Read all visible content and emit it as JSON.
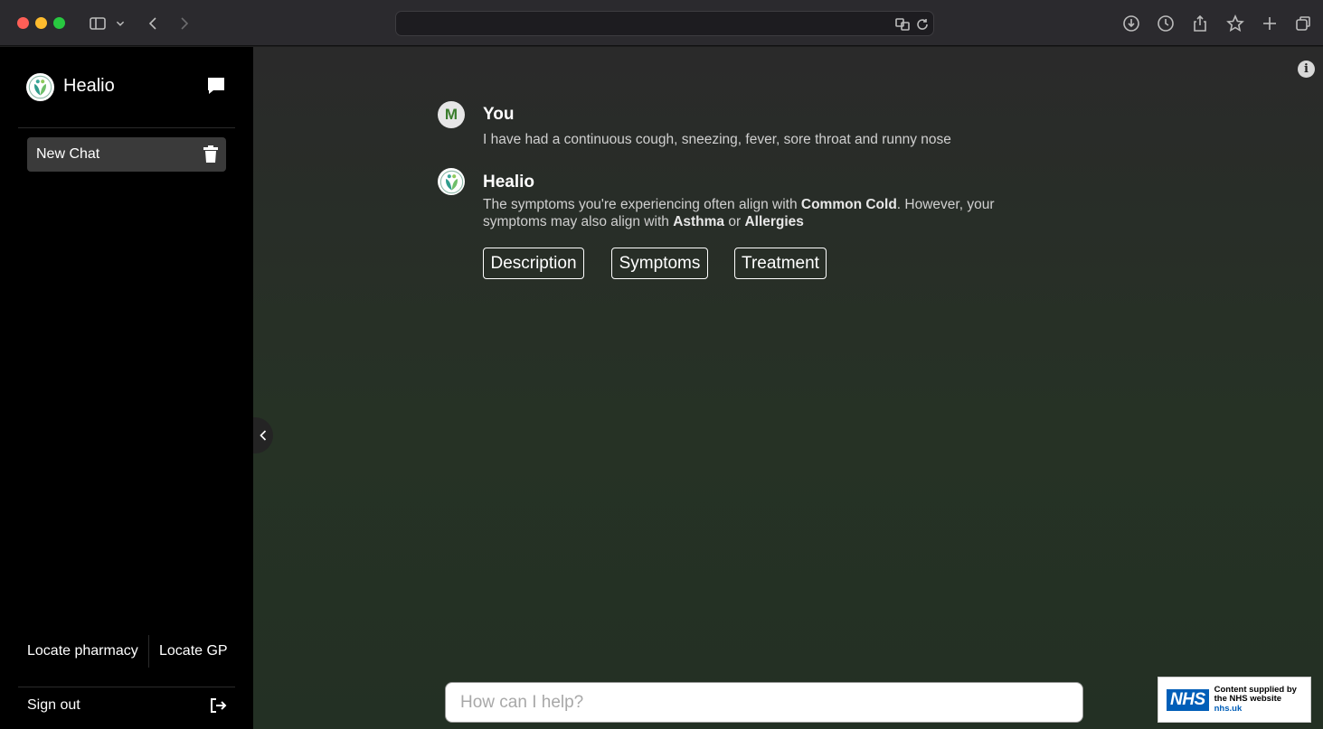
{
  "browser": {
    "url": "",
    "icons": [
      "sidebar-icon",
      "chevron-down-icon",
      "back-icon",
      "forward-icon",
      "translate-icon",
      "reload-icon",
      "download-icon",
      "history-icon",
      "share-icon",
      "bookmark-star-icon",
      "new-tab-icon",
      "tabs-overview-icon"
    ]
  },
  "sidebar": {
    "brand": "Healio",
    "chats": [
      {
        "label": "New Chat"
      }
    ],
    "links": {
      "pharmacy": "Locate pharmacy",
      "gp": "Locate GP"
    },
    "sign_out": "Sign out"
  },
  "conversation": {
    "user": {
      "avatar_letter": "M",
      "name": "You",
      "text": "I have had a continuous cough, sneezing, fever, sore throat and runny nose"
    },
    "bot": {
      "name": "Healio",
      "text_1": "The symptoms you're experiencing often align with ",
      "primary_condition": "Common Cold",
      "text_2": ". However, your symptoms may also align with ",
      "alt_condition_1": "Asthma",
      "text_3": " or ",
      "alt_condition_2": "Allergies",
      "options": [
        "Description",
        "Symptoms",
        "Treatment"
      ]
    }
  },
  "input": {
    "placeholder": "How can I help?"
  },
  "nhs": {
    "logo": "NHS",
    "line1": "Content supplied by",
    "line2": "the NHS website",
    "url": "nhs.uk"
  },
  "colors": {
    "accent_green": "#3a7d2c",
    "nhs_blue": "#005eb8",
    "sidebar_bg": "#000000"
  }
}
